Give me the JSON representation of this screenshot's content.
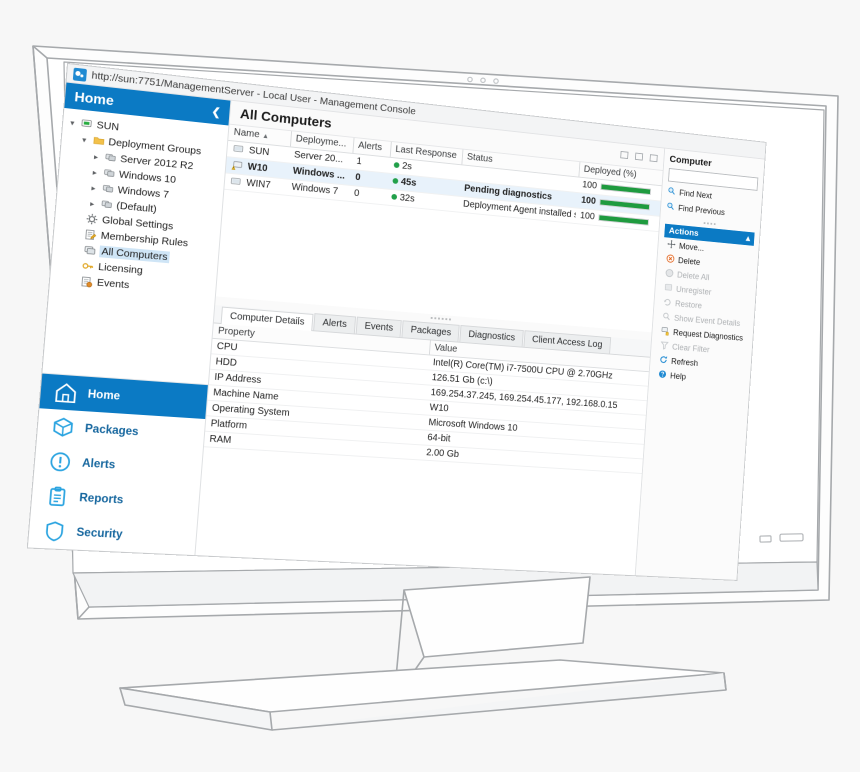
{
  "window": {
    "title": "http://sun:7751/ManagementServer - Local User - Management Console",
    "app_icon": "management-console-icon",
    "dots": [
      "dot-1",
      "dot-2",
      "dot-3"
    ]
  },
  "sidebar": {
    "header": {
      "title": "Home",
      "collapse_icon": "chevron-left-icon"
    },
    "tree": [
      {
        "label": "SUN",
        "depth": 0,
        "expander": "expanded",
        "icon": "server-node-icon",
        "selected": false
      },
      {
        "label": "Deployment Groups",
        "depth": 1,
        "expander": "expanded",
        "icon": "folder-icon",
        "selected": false
      },
      {
        "label": "Server 2012 R2",
        "depth": 2,
        "expander": "collapsed",
        "icon": "group-icon",
        "selected": false
      },
      {
        "label": "Windows 10",
        "depth": 2,
        "expander": "collapsed",
        "icon": "group-icon",
        "selected": false
      },
      {
        "label": "Windows 7",
        "depth": 2,
        "expander": "collapsed",
        "icon": "group-icon",
        "selected": false
      },
      {
        "label": "(Default)",
        "depth": 2,
        "expander": "collapsed",
        "icon": "group-icon",
        "selected": false
      },
      {
        "label": "Global Settings",
        "depth": 1,
        "expander": "none",
        "icon": "gear-icon",
        "selected": false
      },
      {
        "label": "Membership Rules",
        "depth": 1,
        "expander": "none",
        "icon": "rules-icon",
        "selected": false
      },
      {
        "label": "All Computers",
        "depth": 1,
        "expander": "none",
        "icon": "computers-icon",
        "selected": true
      },
      {
        "label": "Licensing",
        "depth": 1,
        "expander": "none",
        "icon": "key-icon",
        "selected": false
      },
      {
        "label": "Events",
        "depth": 1,
        "expander": "none",
        "icon": "events-icon",
        "selected": false
      }
    ],
    "nav_buttons": [
      {
        "label": "Home",
        "icon": "home-icon",
        "active": true
      },
      {
        "label": "Packages",
        "icon": "package-icon",
        "active": false
      },
      {
        "label": "Alerts",
        "icon": "alert-icon",
        "active": false
      },
      {
        "label": "Reports",
        "icon": "report-icon",
        "active": false
      },
      {
        "label": "Security",
        "icon": "shield-icon",
        "active": false
      }
    ]
  },
  "main": {
    "page_title": "All Computers",
    "window_controls": [
      "minimize-icon",
      "restore-icon",
      "close-icon"
    ],
    "grid": {
      "columns": [
        "Name",
        "Deployme...",
        "Alerts",
        "Last Response",
        "Status",
        "Deployed (%)"
      ],
      "sort_column": "Name",
      "sort_direction": "ascending",
      "rows": [
        {
          "icon": "computer-icon",
          "name": "SUN",
          "deployment_group": "Server 20...",
          "alerts": "1",
          "last_response": "2s",
          "status": "",
          "deployed_pct": "100",
          "deployed_value": 100,
          "selected": false
        },
        {
          "icon": "computer-warning-icon",
          "name": "W10",
          "deployment_group": "Windows ...",
          "alerts": "0",
          "last_response": "45s",
          "status": "Pending diagnostics",
          "deployed_pct": "100",
          "deployed_value": 100,
          "selected": true
        },
        {
          "icon": "computer-icon",
          "name": "WIN7",
          "deployment_group": "Windows 7",
          "alerts": "0",
          "last_response": "32s",
          "status": "Deployment Agent installed successfully. Waiting ...",
          "deployed_pct": "100",
          "deployed_value": 100,
          "selected": false
        }
      ]
    },
    "detail_tabs": [
      {
        "label": "Computer Details",
        "active": true
      },
      {
        "label": "Alerts",
        "active": false
      },
      {
        "label": "Events",
        "active": false
      },
      {
        "label": "Packages",
        "active": false
      },
      {
        "label": "Diagnostics",
        "active": false
      },
      {
        "label": "Client Access Log",
        "active": false
      }
    ],
    "properties": {
      "columns": [
        "Property",
        "Value"
      ],
      "rows": [
        {
          "property": "CPU",
          "value": "Intel(R) Core(TM) i7-7500U CPU @ 2.70GHz"
        },
        {
          "property": "HDD",
          "value": "126.51 Gb (c:\\)"
        },
        {
          "property": "IP Address",
          "value": "169.254.37.245,  169.254.45.177,  192.168.0.15"
        },
        {
          "property": "Machine Name",
          "value": "W10"
        },
        {
          "property": "Operating System",
          "value": "Microsoft Windows 10"
        },
        {
          "property": "Platform",
          "value": "64-bit"
        },
        {
          "property": "RAM",
          "value": "2.00 Gb"
        }
      ]
    }
  },
  "right_panel": {
    "title": "Computer",
    "search_value": "",
    "search_placeholder": "",
    "find_links": [
      {
        "label": "Find Next",
        "icon": "search-next-icon"
      },
      {
        "label": "Find Previous",
        "icon": "search-prev-icon"
      }
    ],
    "actions_header": {
      "label": "Actions",
      "collapse_icon": "chevron-up-icon"
    },
    "actions": [
      {
        "label": "Move...",
        "icon": "move-icon",
        "enabled": true
      },
      {
        "label": "Delete",
        "icon": "delete-icon",
        "enabled": true
      },
      {
        "label": "Delete All",
        "icon": "delete-all-icon",
        "enabled": false
      },
      {
        "label": "Unregister",
        "icon": "unregister-icon",
        "enabled": false
      },
      {
        "label": "Restore",
        "icon": "restore-icon",
        "enabled": false
      },
      {
        "label": "Show Event Details",
        "icon": "event-details-icon",
        "enabled": false
      },
      {
        "label": "Request Diagnostics",
        "icon": "request-diagnostics-icon",
        "enabled": true
      },
      {
        "label": "Clear Filter",
        "icon": "clear-filter-icon",
        "enabled": false
      },
      {
        "label": "Refresh",
        "icon": "refresh-icon",
        "enabled": true
      },
      {
        "label": "Help",
        "icon": "help-icon",
        "enabled": true
      }
    ]
  },
  "colors": {
    "accent_blue": "#0b7ac4",
    "nav_icon_blue": "#29a3e0",
    "progress_green": "#1f9b3f",
    "status_dot_green": "#22a04a",
    "selection_blue": "#e8f2fb",
    "frame_gray": "#a6a9ac"
  }
}
